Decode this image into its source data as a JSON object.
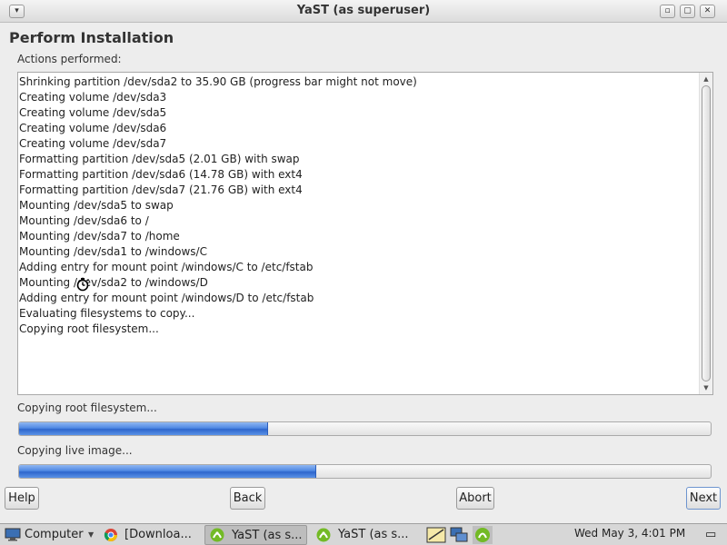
{
  "window": {
    "title": "YaST (as superuser)",
    "menu_glyph": "▾",
    "minimize_glyph": "▫",
    "maximize_glyph": "▢",
    "close_glyph": "✕"
  },
  "page": {
    "heading": "Perform Installation",
    "actions_label": "Actions performed:"
  },
  "log": {
    "lines": [
      "Shrinking partition /dev/sda2 to 35.90 GB (progress bar might not move)",
      "Creating volume /dev/sda3",
      "Creating volume /dev/sda5",
      "Creating volume /dev/sda6",
      "Creating volume /dev/sda7",
      "Formatting partition /dev/sda5 (2.01 GB) with swap",
      "Formatting partition /dev/sda6 (14.78 GB) with ext4",
      "Formatting partition /dev/sda7 (21.76 GB) with ext4",
      "Mounting /dev/sda5 to swap",
      "Mounting /dev/sda6 to /",
      "Mounting /dev/sda7 to /home",
      "Mounting /dev/sda1 to /windows/C",
      "Adding entry for mount point /windows/C to /etc/fstab",
      "Mounting /dev/sda2 to /windows/D",
      "Adding entry for mount point /windows/D to /etc/fstab",
      "Evaluating filesystems to copy...",
      "Copying root filesystem..."
    ]
  },
  "progress": {
    "step": {
      "label": "Copying root filesystem...",
      "fraction": 0.36
    },
    "overall": {
      "label": "Copying live image...",
      "fraction": 0.43
    }
  },
  "buttons": {
    "help": "Help",
    "back": "Back",
    "abort": "Abort",
    "next": "Next"
  },
  "taskbar": {
    "computer": "Computer",
    "task1": "[Downloa...",
    "task2": "YaST (as s...",
    "task3": "YaST (as s...",
    "clock": "Wed May  3,  4:01 PM",
    "show_desktop_glyph": "▭"
  },
  "colors": {
    "progress_fill": "#4f88e3",
    "opensuse_green": "#73ba25"
  },
  "icons": [
    "computer-icon",
    "chrome-icon",
    "yast-icon",
    "panel-icon",
    "network-icon",
    "update-icon",
    "busy-cursor-icon"
  ]
}
